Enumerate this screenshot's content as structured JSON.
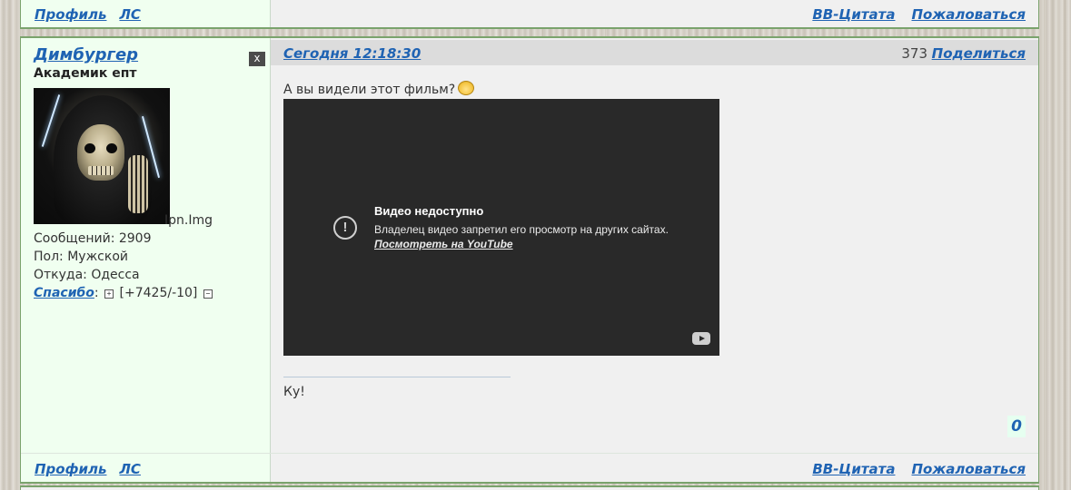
{
  "top_bar": {
    "profile": "Профиль",
    "pm": "ЛС",
    "bb_quote": "BB-Цитата",
    "report": "Пожаловаться"
  },
  "post": {
    "date": "Сегодня 12:18:30",
    "views": "373",
    "share": "Поделиться",
    "text": "А вы видели этот фильм?",
    "video": {
      "title": "Видео недоступно",
      "message": "Владелец видео запретил его просмотр на других сайтах.",
      "link": "Посмотреть на YouTube"
    },
    "signature": "Ку!",
    "rating": "0"
  },
  "author": {
    "name": "Димбургер",
    "close_label": "x",
    "rank": "Академик епт",
    "avatar_caption": "Ipn.Img",
    "posts": "Сообщений: 2909",
    "gender": "Пол: Мужской",
    "location": "Откуда: Одесса",
    "thanks_label": "Спасибо",
    "thanks_sep": ":",
    "thanks_plus": "+",
    "thanks_value": "[+7425/-10]",
    "thanks_minus": "−"
  },
  "bottom_bar": {
    "profile": "Профиль",
    "pm": "ЛС",
    "bb_quote": "BB-Цитата",
    "report": "Пожаловаться"
  }
}
